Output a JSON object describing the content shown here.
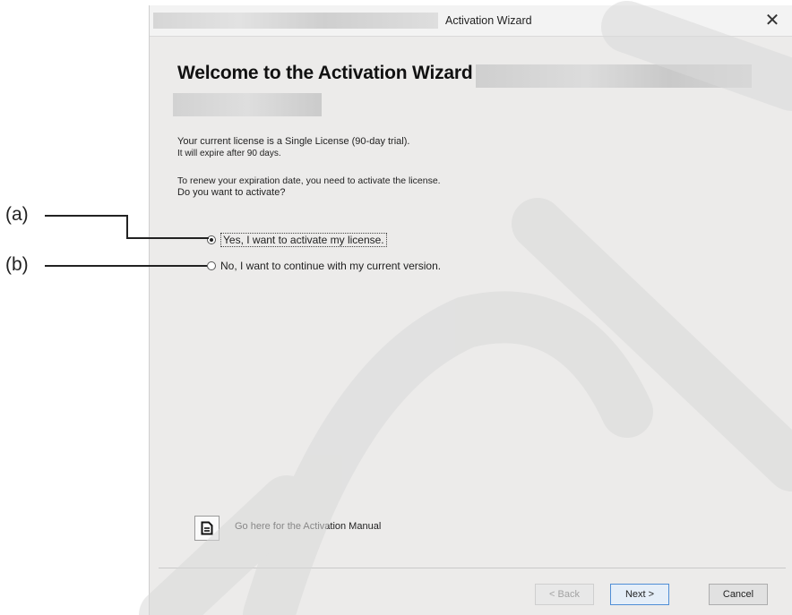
{
  "callouts": {
    "a": "(a)",
    "b": "(b)"
  },
  "window": {
    "title": "Activation Wizard",
    "close_glyph": "✕"
  },
  "heading": "Welcome to the Activation Wizard for",
  "license": {
    "line1": "Your current license is a Single License (90-day trial).",
    "line2": "It will expire after 90 days."
  },
  "prompt": {
    "line1": "To renew your expiration date, you need to activate the license.",
    "line2": "Do you want to activate?"
  },
  "options": {
    "yes_label": "Yes, I want to activate my license.",
    "no_label": "No, I want to continue with my current version.",
    "selected": "yes"
  },
  "manual": {
    "label": "Go here for the Activation Manual",
    "icon": "document-icon"
  },
  "buttons": {
    "back": "< Back",
    "next": "Next >",
    "cancel": "Cancel"
  },
  "colors": {
    "dialog_bg": "#ecebea",
    "accent": "#4f8ed6",
    "watermark": "#d9d9d9"
  }
}
